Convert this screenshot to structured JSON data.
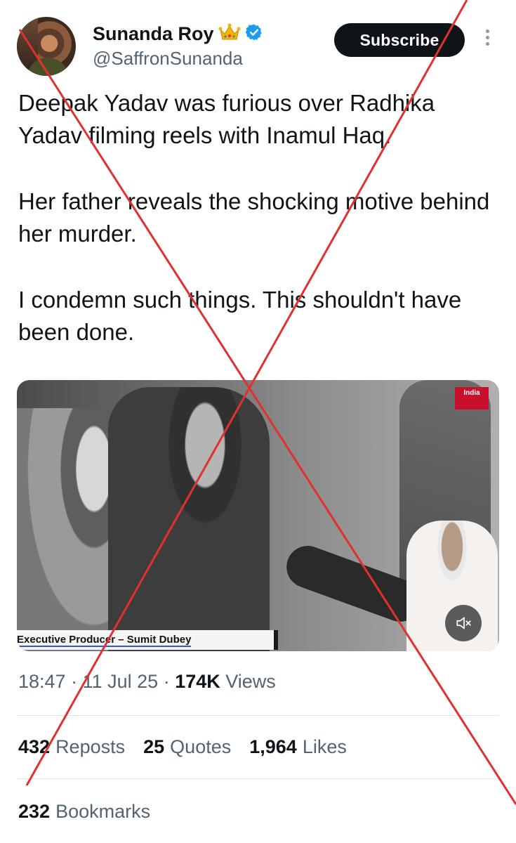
{
  "author": {
    "name": "Sunanda Roy",
    "handle": "@SaffronSunanda",
    "badges": [
      "crown-emoji",
      "verified-icon"
    ]
  },
  "header": {
    "subscribe_label": "Subscribe"
  },
  "tweet": {
    "paragraphs": [
      "Deepak Yadav was furious over Radhika Yadav filming reels with Inamul Haq.",
      "Her father reveals the shocking motive behind her murder.",
      "I condemn such things. This shouldn't have been done."
    ]
  },
  "media": {
    "credit_text": "Executive Producer – Sumit Dubey",
    "channel_logo": "India"
  },
  "meta": {
    "time": "18:47",
    "date": "11 Jul 25",
    "views_count": "174K",
    "views_label": "Views"
  },
  "stats": {
    "reposts_count": "432",
    "reposts_label": "Reposts",
    "quotes_count": "25",
    "quotes_label": "Quotes",
    "likes_count": "1,964",
    "likes_label": "Likes",
    "bookmarks_count": "232",
    "bookmarks_label": "Bookmarks"
  },
  "colors": {
    "accent_black": "#0f1419",
    "secondary_text": "#536471",
    "verified_blue": "#1d9bf0",
    "cross_red": "#e0312f"
  }
}
